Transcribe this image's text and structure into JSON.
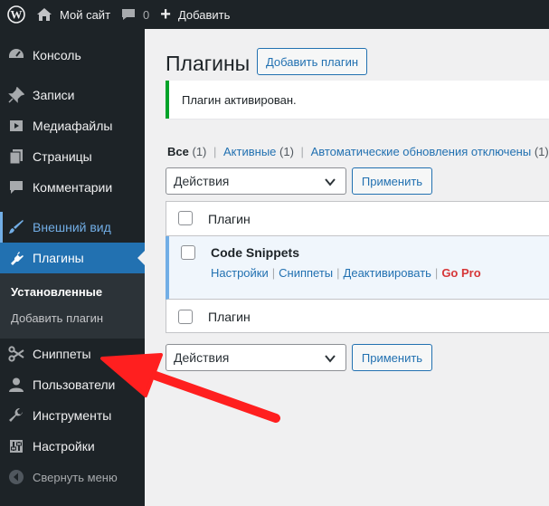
{
  "adminbar": {
    "site_name": "Мой сайт",
    "comments_count": "0",
    "new_label": "Добавить"
  },
  "sidebar": {
    "items": [
      {
        "label": "Консоль",
        "icon": "dashboard-icon"
      },
      {
        "label": "Записи",
        "icon": "pin-icon"
      },
      {
        "label": "Медиафайлы",
        "icon": "media-icon"
      },
      {
        "label": "Страницы",
        "icon": "pages-icon"
      },
      {
        "label": "Комментарии",
        "icon": "comment-icon"
      },
      {
        "label": "Внешний вид",
        "icon": "brush-icon"
      },
      {
        "label": "Плагины",
        "icon": "plugin-icon"
      },
      {
        "label": "Сниппеты",
        "icon": "scissors-icon"
      },
      {
        "label": "Пользователи",
        "icon": "user-icon"
      },
      {
        "label": "Инструменты",
        "icon": "wrench-icon"
      },
      {
        "label": "Настройки",
        "icon": "settings-icon"
      },
      {
        "label": "Свернуть меню",
        "icon": "collapse-icon"
      }
    ],
    "submenu": [
      "Установленные",
      "Добавить плагин"
    ]
  },
  "main": {
    "title": "Плагины",
    "add_button": "Добавить плагин",
    "notice": "Плагин активирован.",
    "filters": {
      "all": "Все",
      "all_count": "(1)",
      "active": "Активные",
      "active_count": "(1)",
      "auto_off": "Автоматические обновления отключены",
      "auto_off_count": "(1)"
    },
    "bulk_select": "Действия",
    "apply_label": "Применить",
    "table": {
      "header": "Плагин",
      "footer": "Плагин",
      "plugin": {
        "name": "Code Snippets",
        "actions": [
          "Настройки",
          "Сниппеты",
          "Деактивировать",
          "Go Pro"
        ]
      }
    }
  },
  "colors": {
    "admin_dark": "#1d2327",
    "accent": "#2271b1",
    "success": "#00a32a",
    "annotation_arrow": "#ff1f1f",
    "go_pro": "#d63638"
  }
}
